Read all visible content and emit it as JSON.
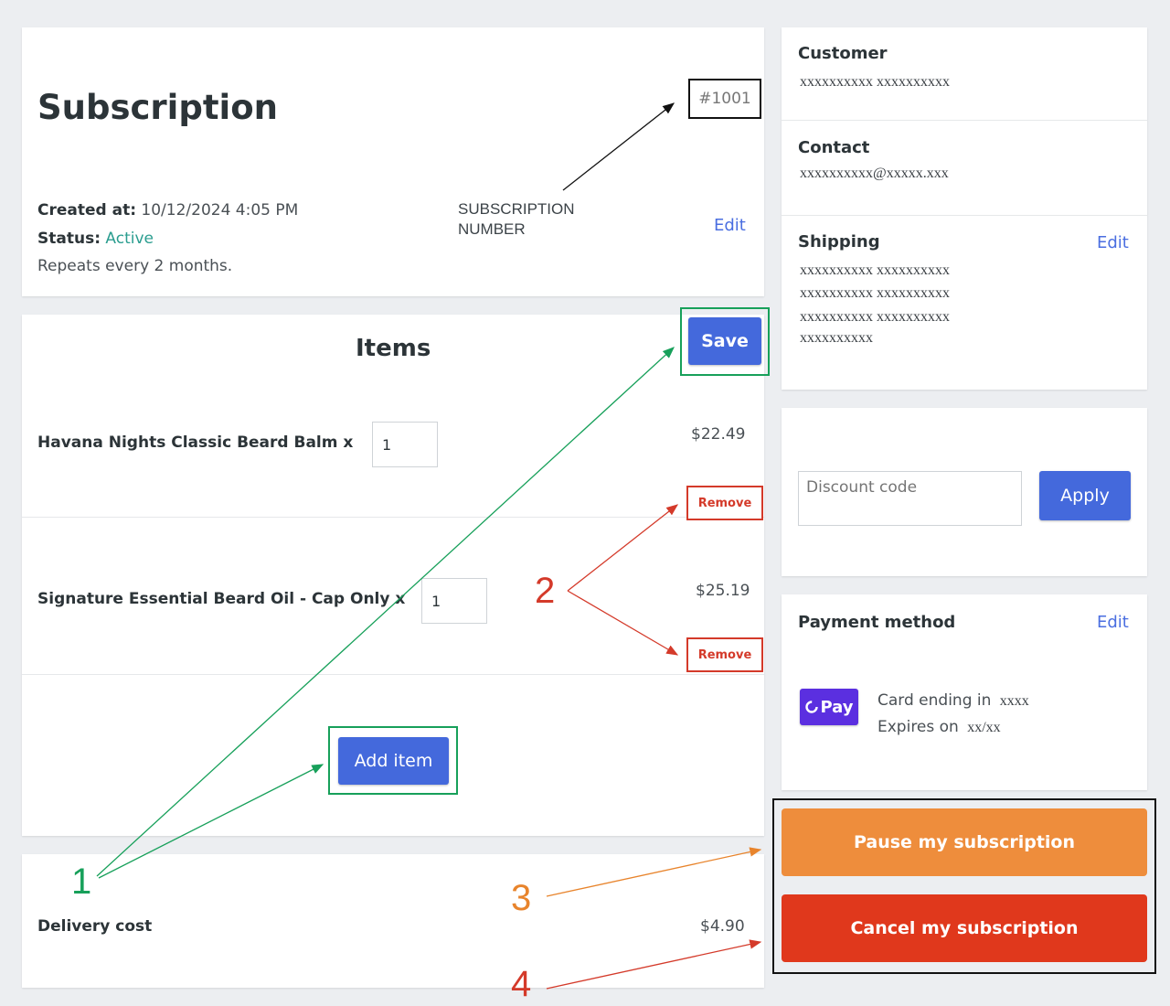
{
  "subscription": {
    "title": "Subscription",
    "number": "#1001",
    "created_label": "Created at:",
    "created_value": "10/12/2024 4:05 PM",
    "status_label": "Status:",
    "status_value": "Active",
    "repeats": "Repeats every 2 months.",
    "edit": "Edit",
    "number_annotation_line1": "SUBSCRIPTION",
    "number_annotation_line2": "NUMBER"
  },
  "items": {
    "title": "Items",
    "save": "Save",
    "add_item": "Add item",
    "list": [
      {
        "name": "Havana Nights Classic Beard Balm x",
        "qty": "1",
        "price": "$22.49",
        "remove": "Remove"
      },
      {
        "name": "Signature Essential Beard Oil - Cap Only x",
        "qty": "1",
        "price": "$25.19",
        "remove": "Remove"
      }
    ]
  },
  "delivery": {
    "label": "Delivery cost",
    "value": "$4.90"
  },
  "customer": {
    "label": "Customer",
    "value": "xxxxxxxxxx xxxxxxxxxx"
  },
  "contact": {
    "label": "Contact",
    "value": "xxxxxxxxxx@xxxxx.xxx"
  },
  "shipping": {
    "label": "Shipping",
    "edit": "Edit",
    "lines": [
      "xxxxxxxxxx xxxxxxxxxx",
      "xxxxxxxxxx xxxxxxxxxx",
      "xxxxxxxxxx xxxxxxxxxx",
      "xxxxxxxxxx"
    ]
  },
  "discount": {
    "placeholder": "Discount code",
    "apply": "Apply"
  },
  "payment": {
    "label": "Payment method",
    "edit": "Edit",
    "logo_text": "Pay",
    "card_label": "Card ending in",
    "card_value": "xxxx",
    "expires_label": "Expires on",
    "expires_value": "xx/xx"
  },
  "actions": {
    "pause": "Pause my subscription",
    "cancel": "Cancel my subscription"
  },
  "annotations": {
    "one": "1",
    "two": "2",
    "three": "3",
    "four": "4"
  },
  "colors": {
    "accent_blue": "#4469dc",
    "active_green": "#2a9d8f",
    "remove_red": "#d43a2a",
    "pause_orange": "#ee8d3c",
    "cancel_red": "#e0381c",
    "annotation_green": "#17a05a",
    "annotation_red": "#d43a2a",
    "annotation_orange": "#e8842c",
    "opay_purple": "#5b2fe0"
  }
}
